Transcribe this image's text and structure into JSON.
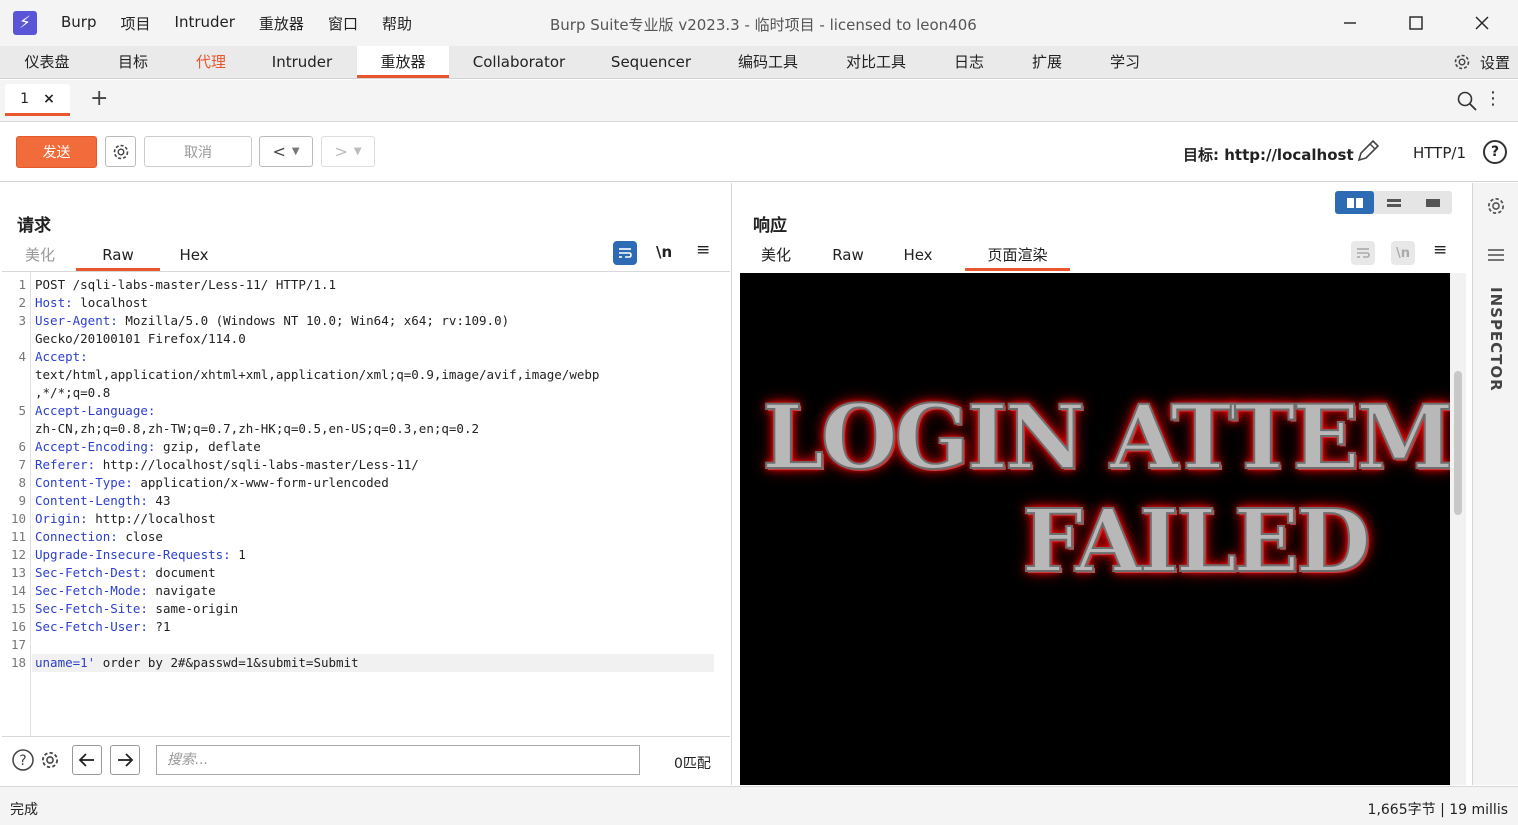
{
  "app": {
    "logo": "⚡",
    "menu": [
      "Burp",
      "项目",
      "Intruder",
      "重放器",
      "窗口",
      "帮助"
    ],
    "title": "Burp Suite专业版  v2023.3 - 临时项目 - licensed to leon406"
  },
  "main_tabs": [
    "仪表盘",
    "目标",
    "代理",
    "Intruder",
    "重放器",
    "Collaborator",
    "Sequencer",
    "编码工具",
    "对比工具",
    "日志",
    "扩展",
    "学习"
  ],
  "settings_label": "设置",
  "repeater_tab": {
    "label": "1",
    "close": "×"
  },
  "toolbar": {
    "send": "发送",
    "cancel": "取消",
    "target": "目标: http://localhost",
    "http_version": "HTTP/1",
    "help": "?"
  },
  "request": {
    "title": "请求",
    "tabs": [
      "美化",
      "Raw",
      "Hex"
    ],
    "newline_toggle": "\\n",
    "lines": [
      {
        "n": "1",
        "key": "",
        "text": "POST /sqli-labs-master/Less-11/ HTTP/1.1"
      },
      {
        "n": "2",
        "key": "Host:",
        "text": " localhost"
      },
      {
        "n": "3",
        "key": "User-Agent:",
        "text": " Mozilla/5.0 (Windows NT 10.0; Win64; x64; rv:109.0)"
      },
      {
        "n": "",
        "key": "",
        "text": "Gecko/20100101 Firefox/114.0"
      },
      {
        "n": "4",
        "key": "Accept:",
        "text": ""
      },
      {
        "n": "",
        "key": "",
        "text": "text/html,application/xhtml+xml,application/xml;q=0.9,image/avif,image/webp"
      },
      {
        "n": "",
        "key": "",
        "text": ",*/*;q=0.8"
      },
      {
        "n": "5",
        "key": "Accept-Language:",
        "text": ""
      },
      {
        "n": "",
        "key": "",
        "text": "zh-CN,zh;q=0.8,zh-TW;q=0.7,zh-HK;q=0.5,en-US;q=0.3,en;q=0.2"
      },
      {
        "n": "6",
        "key": "Accept-Encoding:",
        "text": " gzip, deflate"
      },
      {
        "n": "7",
        "key": "Referer:",
        "text": " http://localhost/sqli-labs-master/Less-11/"
      },
      {
        "n": "8",
        "key": "Content-Type:",
        "text": " application/x-www-form-urlencoded"
      },
      {
        "n": "9",
        "key": "Content-Length:",
        "text": " 43"
      },
      {
        "n": "10",
        "key": "Origin:",
        "text": " http://localhost"
      },
      {
        "n": "11",
        "key": "Connection:",
        "text": " close"
      },
      {
        "n": "12",
        "key": "Upgrade-Insecure-Requests:",
        "text": " 1"
      },
      {
        "n": "13",
        "key": "Sec-Fetch-Dest:",
        "text": " document"
      },
      {
        "n": "14",
        "key": "Sec-Fetch-Mode:",
        "text": " navigate"
      },
      {
        "n": "15",
        "key": "Sec-Fetch-Site:",
        "text": " same-origin"
      },
      {
        "n": "16",
        "key": "Sec-Fetch-User:",
        "text": " ?1"
      },
      {
        "n": "17",
        "key": "",
        "text": ""
      },
      {
        "n": "18",
        "key": "uname=1'",
        "text": " order by 2#&passwd=1&submit=Submit"
      }
    ],
    "search_placeholder": "搜索...",
    "matches": "0匹配"
  },
  "response": {
    "title": "响应",
    "tabs": [
      "美化",
      "Raw",
      "Hex",
      "页面渲染"
    ],
    "newline_toggle": "\\n",
    "render_line1": "LOGIN ATTEMPT",
    "render_line2": "FAILED"
  },
  "inspector_label": "INSPECTOR",
  "status": {
    "left": "完成",
    "right": "1,665字节 | 19 millis"
  },
  "colors": {
    "accent": "#e8572d",
    "send": "#f26b3a",
    "key": "#2c3fcf",
    "toggle_on": "#2d6cb5"
  }
}
